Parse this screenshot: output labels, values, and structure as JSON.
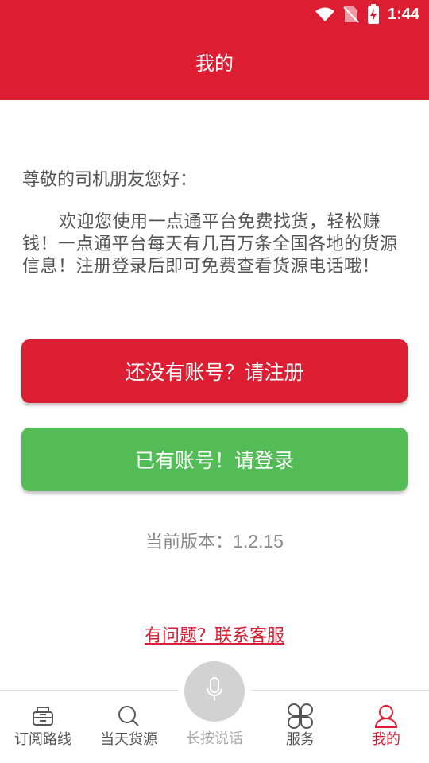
{
  "status_bar": {
    "time": "1:44"
  },
  "header": {
    "title": "我的"
  },
  "main": {
    "greeting": "尊敬的司机朋友您好：",
    "welcome": "欢迎您使用一点通平台免费找货，轻松赚钱！一点通平台每天有几百万条全国各地的货源信息！注册登录后即可免费查看货源电话哦！",
    "register_button": "还没有账号？请注册",
    "login_button": "已有账号！请登录",
    "version_label": "当前版本：",
    "version_number": "1.2.15",
    "contact_link": "有问题？联系客服"
  },
  "bottom_nav": {
    "items": [
      {
        "label": "订阅路线",
        "icon": "subscribe-route-icon"
      },
      {
        "label": "当天货源",
        "icon": "search-icon"
      },
      {
        "label": "长按说话",
        "icon": "microphone-icon"
      },
      {
        "label": "服务",
        "icon": "service-grid-icon"
      },
      {
        "label": "我的",
        "icon": "user-icon"
      }
    ],
    "active_index": 4
  },
  "colors": {
    "brand_red": "#dd1e32",
    "login_green": "#53bc57",
    "mic_gray": "#d2d2d2"
  }
}
